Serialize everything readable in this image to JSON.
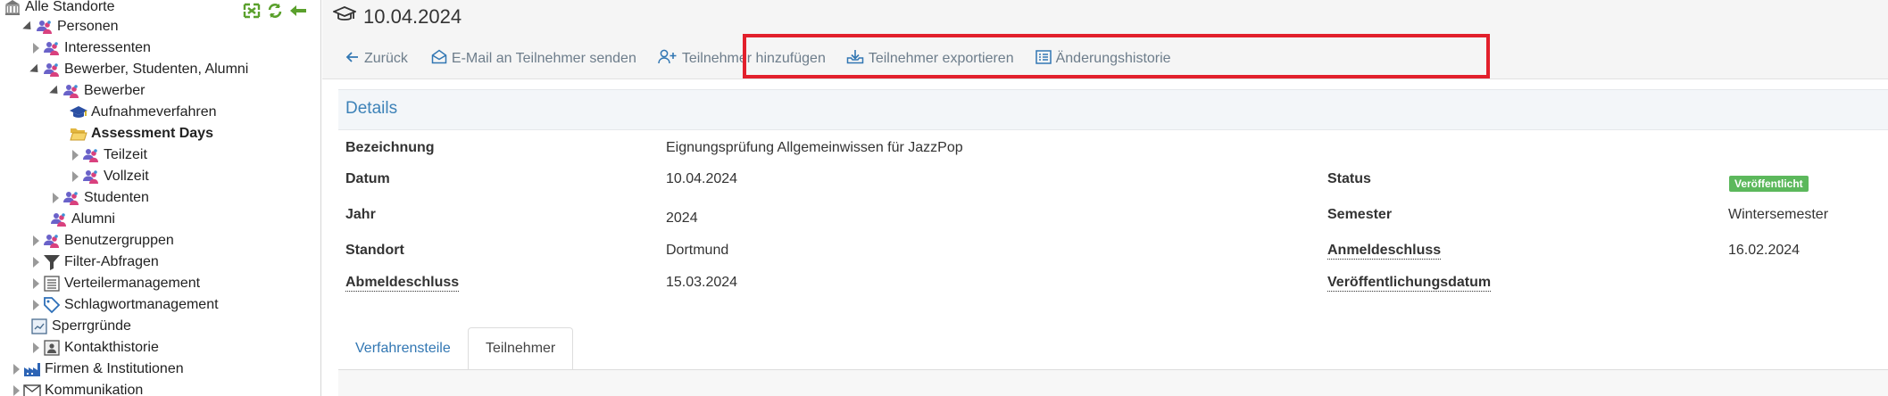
{
  "colors": {
    "link": "#3277b3",
    "action": "#6d7d8b",
    "highlight": "#e2202c",
    "badge_green": "#5cb85c",
    "details_title": "#3d82b8"
  },
  "tree": {
    "items": [
      {
        "label": "Alle Standorte",
        "icon": "building-icon",
        "bold": false
      },
      {
        "label": "Personen",
        "icon": "people-icon",
        "bold": false
      },
      {
        "label": "Interessenten",
        "icon": "people-icon",
        "bold": false
      },
      {
        "label": "Bewerber, Studenten, Alumni",
        "icon": "people-icon",
        "bold": false
      },
      {
        "label": "Bewerber",
        "icon": "people-icon",
        "bold": false
      },
      {
        "label": "Aufnahmeverfahren",
        "icon": "graduation-cap-icon",
        "bold": false
      },
      {
        "label": "Assessment Days",
        "icon": "folder-open-icon",
        "bold": true
      },
      {
        "label": "Teilzeit",
        "icon": "people-icon",
        "bold": false
      },
      {
        "label": "Vollzeit",
        "icon": "people-icon",
        "bold": false
      },
      {
        "label": "Studenten",
        "icon": "people-icon",
        "bold": false
      },
      {
        "label": "Alumni",
        "icon": "people-icon",
        "bold": false
      },
      {
        "label": "Benutzergruppen",
        "icon": "people-icon",
        "bold": false
      },
      {
        "label": "Filter-Abfragen",
        "icon": "funnel-icon",
        "bold": false
      },
      {
        "label": "Verteilermanagement",
        "icon": "list-icon",
        "bold": false
      },
      {
        "label": "Schlagwortmanagement",
        "icon": "tag-icon",
        "bold": false
      },
      {
        "label": "Sperrgründe",
        "icon": "blocked-list-icon",
        "bold": false
      },
      {
        "label": "Kontakthistorie",
        "icon": "contact-history-icon",
        "bold": false
      },
      {
        "label": "Firmen & Institutionen",
        "icon": "factory-icon",
        "bold": false
      },
      {
        "label": "Kommunikation",
        "icon": "envelope-icon",
        "bold": false
      }
    ],
    "tools": [
      "expand-all-icon",
      "refresh-icon",
      "collapse-arrow-icon"
    ]
  },
  "header": {
    "title": "10.04.2024",
    "icon": "graduation-cap-icon"
  },
  "actions": {
    "back": "Zurück",
    "email": "E-Mail an Teilnehmer senden",
    "add": "Teilnehmer hinzufügen",
    "export": "Teilnehmer exportieren",
    "history": "Änderungshistorie"
  },
  "details": {
    "title": "Details",
    "bezeichnung_label": "Bezeichnung",
    "bezeichnung_value": "Eignungsprüfung Allgemeinwissen für JazzPop",
    "datum_label": "Datum",
    "datum_value": "10.04.2024",
    "status_label": "Status",
    "status_value": "Veröffentlicht",
    "jahr_label": "Jahr",
    "jahr_value": "2024",
    "semester_label": "Semester",
    "semester_value": "Wintersemester",
    "standort_label": "Standort",
    "standort_value": "Dortmund",
    "anmeldeschluss_label": "Anmeldeschluss",
    "anmeldeschluss_value": "16.02.2024",
    "abmeldeschluss_label": "Abmeldeschluss",
    "abmeldeschluss_value": "15.03.2024",
    "veroeffentlichungsdatum_label": "Veröffentlichungsdatum",
    "veroeffentlichungsdatum_value": ""
  },
  "tabs": [
    {
      "label": "Verfahrensteile",
      "active": false
    },
    {
      "label": "Teilnehmer",
      "active": true
    }
  ]
}
